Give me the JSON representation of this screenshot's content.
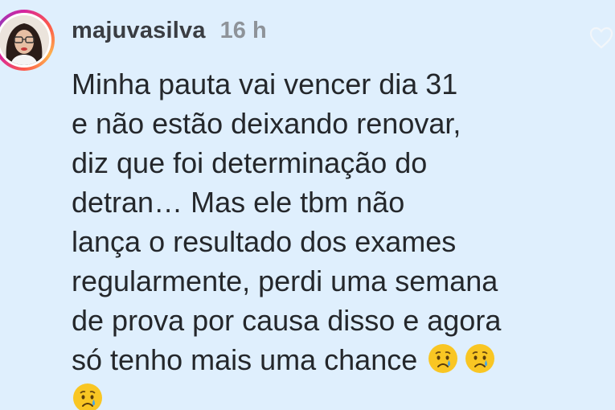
{
  "comment": {
    "username": "majuvasilva",
    "time_ago": "16 h",
    "lines": [
      "Minha pauta vai vencer dia 31",
      "e não estão deixando renovar,",
      "diz que foi determinação do",
      "detran… Mas ele tbm não",
      "lança o resultado dos exames",
      "regularmente, perdi uma semana",
      "de prova por causa disso e agora",
      "só tenho mais uma chance"
    ],
    "emoji": "crying-face"
  },
  "icons": [
    "avatar",
    "heart-icon",
    "crying-face-icon"
  ],
  "colors": {
    "background": "#dfeffd",
    "username": "#3a3d42",
    "timestamp": "#8e9399",
    "text": "#24272b",
    "story_ring": "#d6249f"
  }
}
